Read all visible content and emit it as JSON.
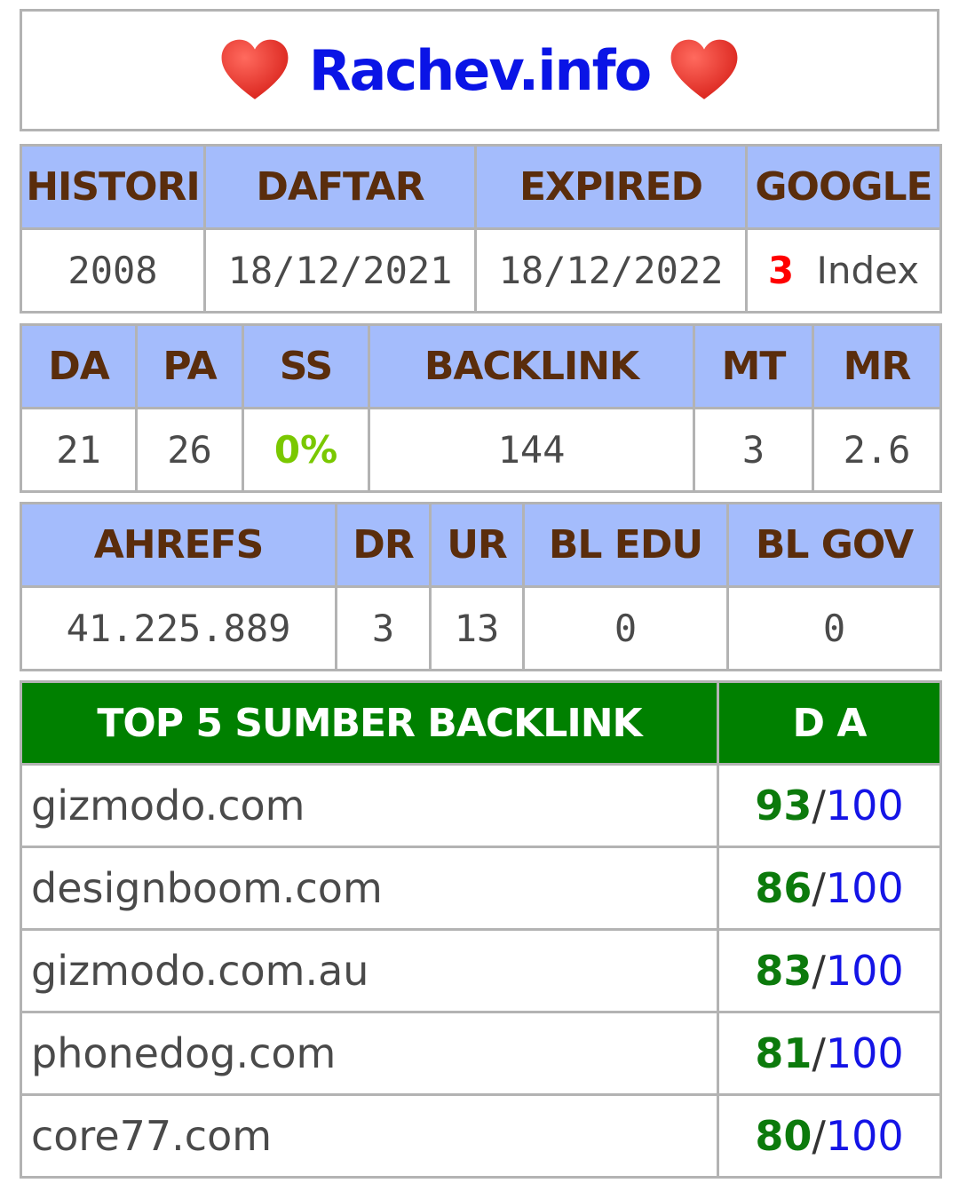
{
  "title": {
    "text": "Rachev.info",
    "left_icon": "heart-icon",
    "right_icon": "heart-icon",
    "heart_color": "#e8332f",
    "text_color": "#0a14e6"
  },
  "domain_info": {
    "headers": [
      "HISTORI",
      "DAFTAR",
      "EXPIRED",
      "GOOGLE"
    ],
    "histori": "2008",
    "daftar": "18/12/2021",
    "expired": "18/12/2022",
    "google_count": "3",
    "google_suffix": "Index"
  },
  "moz": {
    "headers": [
      "DA",
      "PA",
      "SS",
      "BACKLINK",
      "MT",
      "MR"
    ],
    "da": "21",
    "pa": "26",
    "ss": "0%",
    "backlink": "144",
    "mt": "3",
    "mr": "2.6"
  },
  "ahrefs": {
    "headers": [
      "AHREFS",
      "DR",
      "UR",
      "BL EDU",
      "BL GOV"
    ],
    "rank": "41.225.889",
    "dr": "3",
    "ur": "13",
    "bl_edu": "0",
    "bl_gov": "0"
  },
  "top_backlinks": {
    "headers": [
      "TOP 5 SUMBER BACKLINK",
      "D A"
    ],
    "rows": [
      {
        "site": "gizmodo.com",
        "score": "93",
        "slash": "/",
        "max": "100"
      },
      {
        "site": "designboom.com",
        "score": "86",
        "slash": "/",
        "max": "100"
      },
      {
        "site": "gizmodo.com.au",
        "score": "83",
        "slash": "/",
        "max": "100"
      },
      {
        "site": "phonedog.com",
        "score": "81",
        "slash": "/",
        "max": "100"
      },
      {
        "site": "core77.com",
        "score": "80",
        "slash": "/",
        "max": "100"
      }
    ]
  },
  "colors": {
    "header_bg": "#a4bcfc",
    "header_text": "#5a2d0c",
    "top_header_bg": "#008000",
    "score_green": "#0c7a0c",
    "max_blue": "#1414e6",
    "google_red": "#ff0000",
    "ss_green": "#7ac800"
  }
}
